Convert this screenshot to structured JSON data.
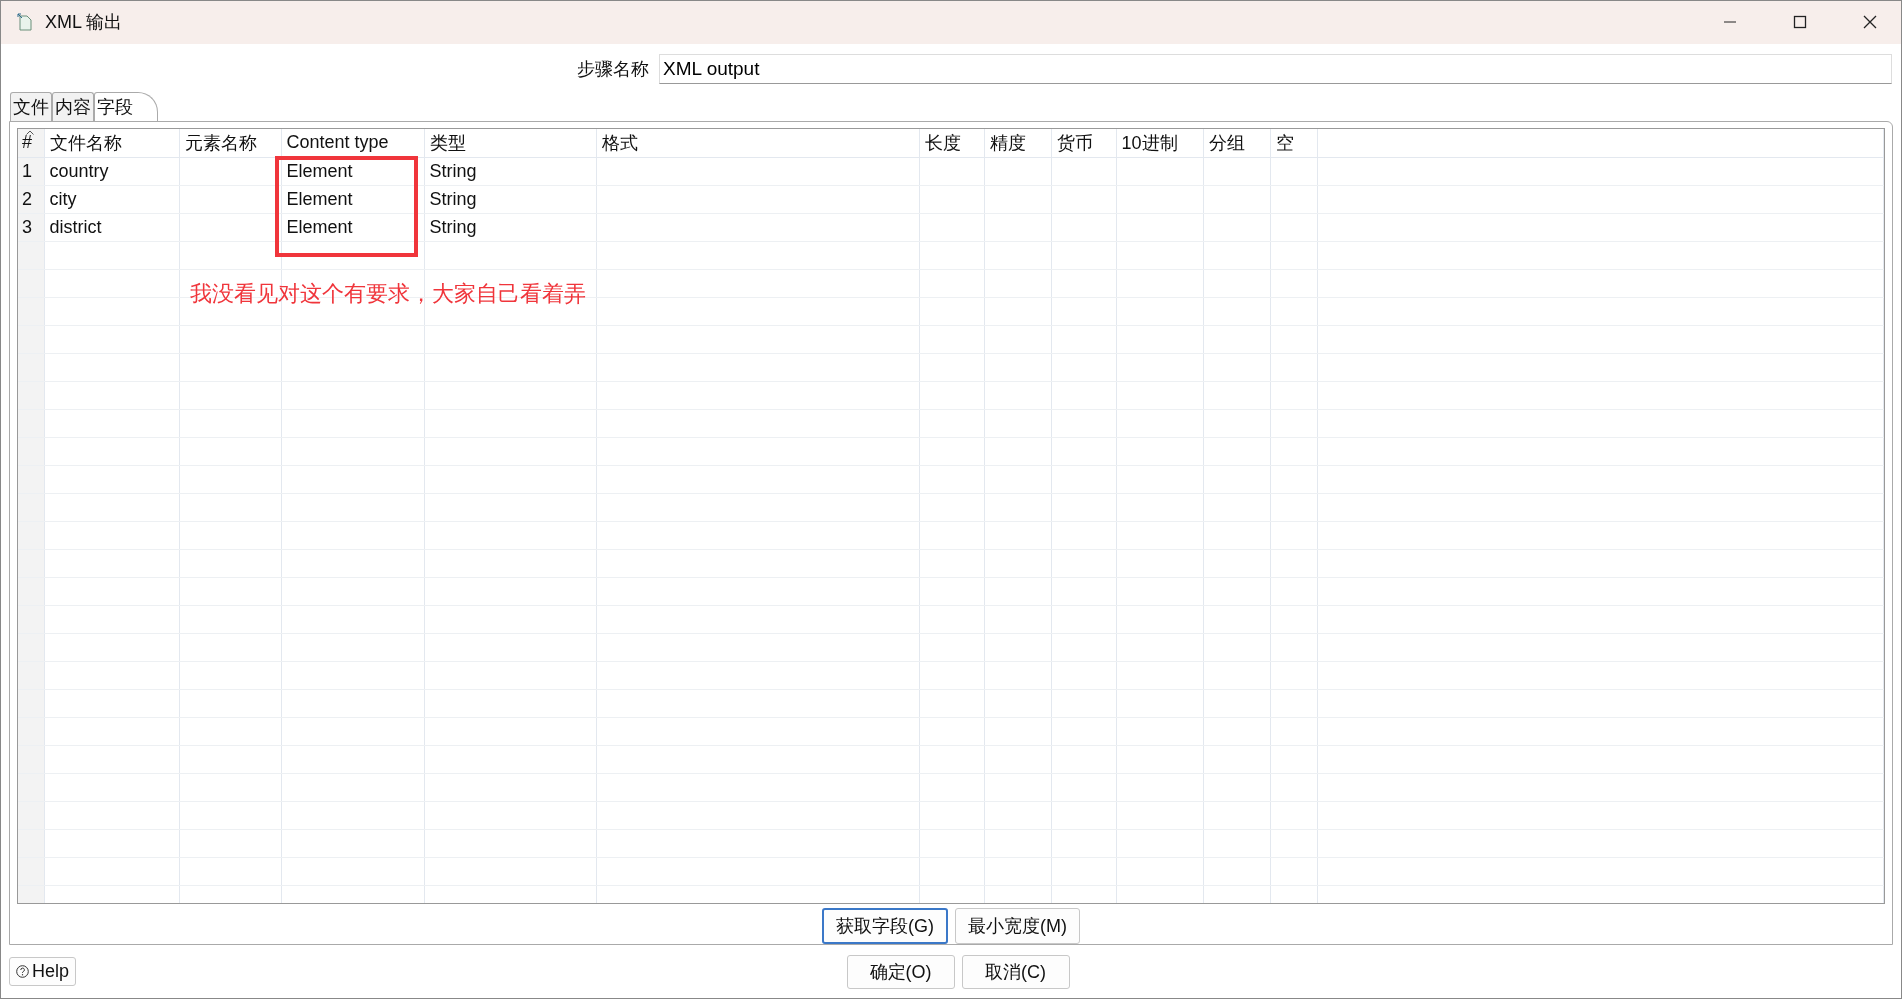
{
  "window": {
    "title": "XML 输出"
  },
  "step_name": {
    "label": "步骤名称",
    "value": "XML output"
  },
  "tabs": [
    {
      "label": "文件",
      "selected": false
    },
    {
      "label": "内容",
      "selected": false
    },
    {
      "label": "字段",
      "selected": true
    }
  ],
  "table": {
    "columns": [
      "#",
      "文件名称",
      "元素名称",
      "Content type",
      "类型",
      "格式",
      "长度",
      "精度",
      "货币",
      "10进制",
      "分组",
      "空"
    ],
    "rows": [
      {
        "number": "1",
        "name": "country",
        "content_type": "Element",
        "type": "String"
      },
      {
        "number": "2",
        "name": "city",
        "content_type": "Element",
        "type": "String"
      },
      {
        "number": "3",
        "name": "district",
        "content_type": "Element",
        "type": "String"
      }
    ]
  },
  "annotation": {
    "text": "我没看见对这个有要求，大家自己看着弄"
  },
  "panel_buttons": [
    {
      "label": "获取字段(G)",
      "focused": true
    },
    {
      "label": "最小宽度(M)",
      "focused": false
    }
  ],
  "help_button": {
    "label": "Help"
  },
  "dialog_buttons": [
    {
      "label": "确定(O)",
      "focused": false
    },
    {
      "label": "取消(C)",
      "focused": false
    }
  ]
}
